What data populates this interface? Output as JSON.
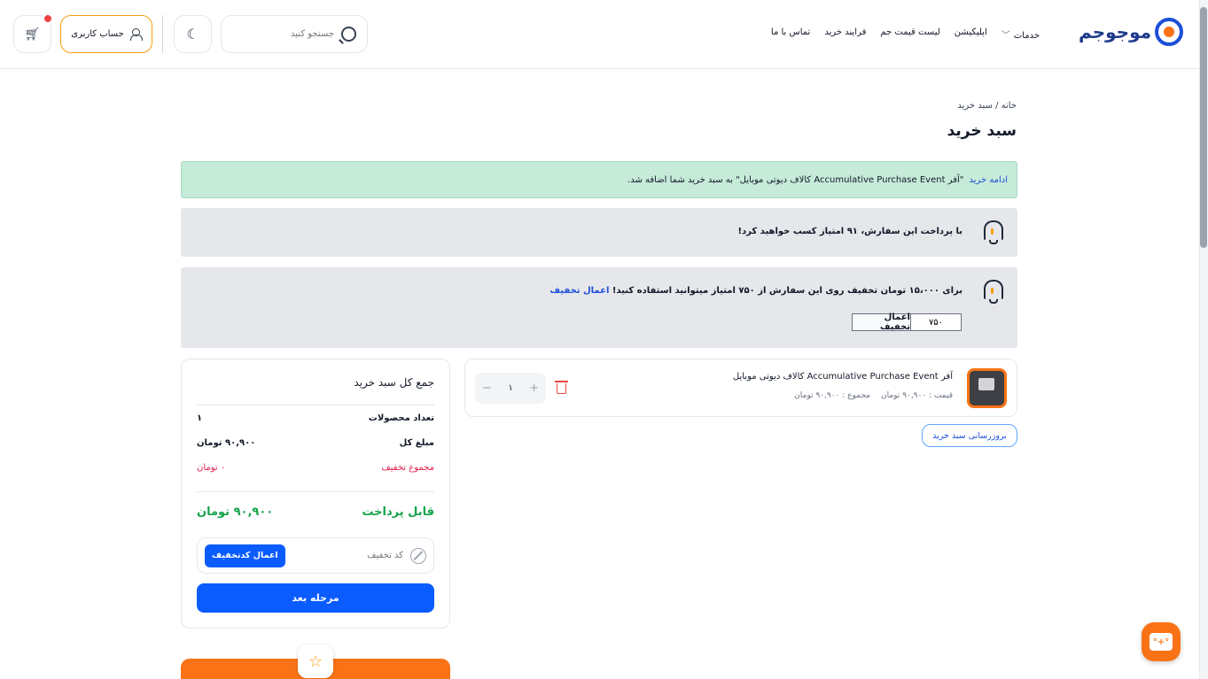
{
  "header": {
    "logo_text": "موجوجم",
    "nav": {
      "services": "خدمات",
      "application": "اپلیکیشن",
      "price_list": "لیست قیمت جم",
      "purchase_process": "فرایند خرید",
      "contact": "تماس با ما"
    },
    "search_placeholder": "جستجو کنید",
    "account_label": "حساب کاربری"
  },
  "breadcrumb": {
    "home": "خانه /",
    "current": "سبد خرید"
  },
  "page_title": "سبد خرید",
  "alerts": {
    "success_link": "ادامه خرید",
    "success_text": "\"آفر Accumulative Purchase Event کالاف دیوتی موبایل\" به سبد خرید شما اضافه شد.",
    "points_earn": "با پرداخت این سفارش، ۹۱ امتیاز کسب خواهید کرد!",
    "points_discount_text": "برای ۱۵،۰۰۰ تومان تخفیف روی این سفارش از ۷۵۰ امتیاز میتوانید استفاده کنید!",
    "points_discount_link": "اعمال تخفیف",
    "points_input_value": "۷۵۰",
    "apply_points_button": "اعمال تخفیف"
  },
  "cart_item": {
    "name": "آفر Accumulative Purchase Event کالاف دیوتی موبایل",
    "price": "قیمت : ۹۰,۹۰۰ تومان",
    "total": "مجموع : ۹۰,۹۰۰ تومان",
    "quantity": "۱",
    "minus": "−",
    "plus": "+"
  },
  "update_cart_button": "بروزرسانی سبد خرید",
  "summary": {
    "title": "جمع کل سبد خرید",
    "count_label": "تعداد محصولات",
    "count_value": "۱",
    "subtotal_label": "مبلغ کل",
    "subtotal_value": "۹۰,۹۰۰ تومان",
    "discount_label": "مجموع تخفیف",
    "discount_value": "۰ تومان",
    "payable_label": "قابل پرداخت",
    "payable_value": "۹۰,۹۰۰ تومان",
    "coupon_placeholder": "کد تخفیف",
    "coupon_button": "اعمال کدتخفیف",
    "next_button": "مرحله بعد"
  },
  "chat_icon_text": "°+°",
  "colors": {
    "primary": "#0b5cff",
    "accent": "#f97316",
    "success_bg": "#c6ebd9",
    "discount": "#e11d48",
    "payable": "#16a34a"
  }
}
